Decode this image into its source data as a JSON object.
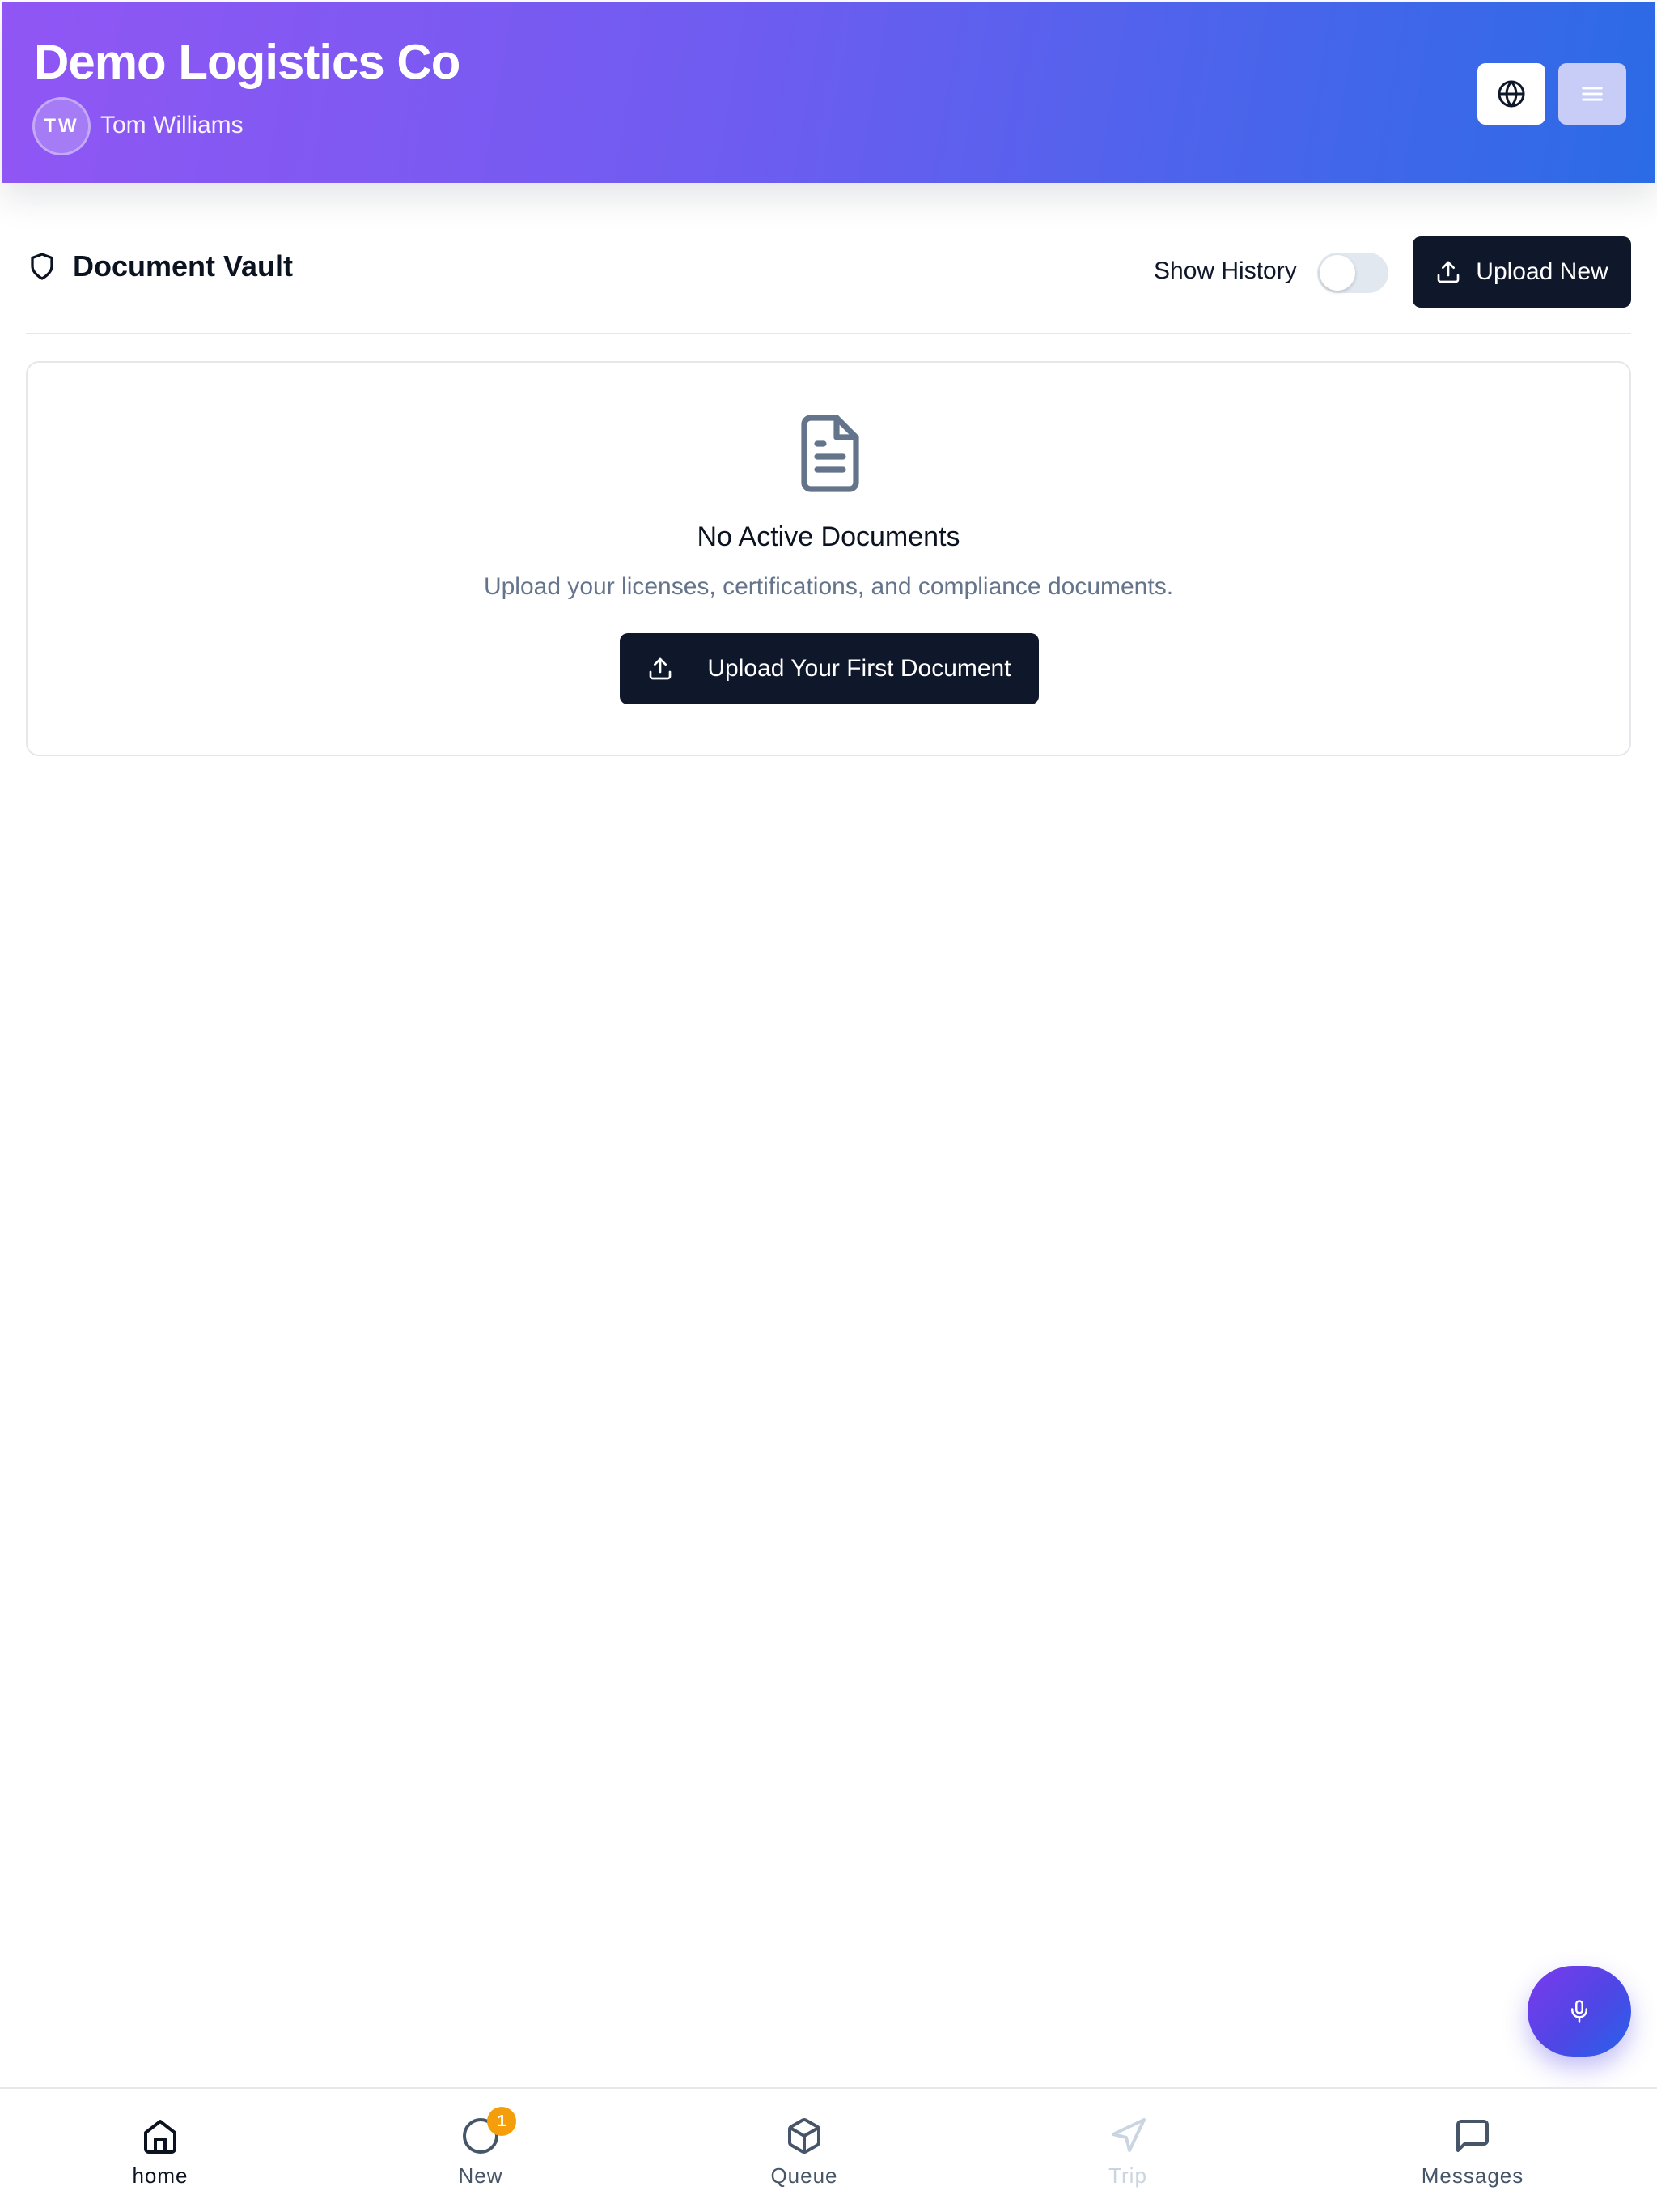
{
  "header": {
    "company": "Demo Logistics Co",
    "user_initials": "TW",
    "user_name": "Tom Williams",
    "gradient_colors": [
      "#9156f4",
      "#2b6be6"
    ]
  },
  "vault": {
    "title": "Document Vault",
    "show_history_label": "Show History",
    "show_history_on": false,
    "upload_new_label": "Upload New"
  },
  "empty_state": {
    "title": "No Active Documents",
    "description": "Upload your licenses, certifications, and compliance documents.",
    "button_label": "Upload Your First Document"
  },
  "nav": {
    "items": [
      {
        "label": "home",
        "icon": "home-icon",
        "active": true
      },
      {
        "label": "New",
        "icon": "clock-icon",
        "badge": "1"
      },
      {
        "label": "Queue",
        "icon": "package-icon"
      },
      {
        "label": "Trip",
        "icon": "navigation-icon",
        "disabled": true
      },
      {
        "label": "Messages",
        "icon": "message-icon"
      }
    ]
  },
  "colors": {
    "primary_dark": "#0f172a",
    "badge": "#f59e0b",
    "muted_text": "#64748b"
  }
}
